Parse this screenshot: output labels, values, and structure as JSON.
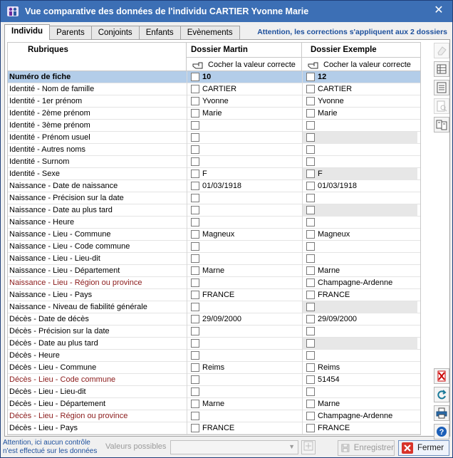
{
  "window": {
    "title": "Vue comparative des données de l'individu  CARTIER Yvonne Marie",
    "close_glyph": "✕"
  },
  "tabs": [
    {
      "label": "Individu",
      "active": true
    },
    {
      "label": "Parents",
      "active": false
    },
    {
      "label": "Conjoints",
      "active": false
    },
    {
      "label": "Enfants",
      "active": false
    },
    {
      "label": "Evènements",
      "active": false
    }
  ],
  "warning_top": "Attention, les corrections s'appliquent aux 2 dossiers",
  "grid": {
    "header": {
      "rubriques": "Rubriques",
      "dossier_a": "Dossier Martin",
      "dossier_b": "Dossier Exemple",
      "check_label_a": "Cocher la valeur correcte",
      "check_label_b": "Cocher la valeur correcte"
    },
    "rows": [
      {
        "label": "Numéro de fiche",
        "a": "10",
        "b": "12",
        "selected": true
      },
      {
        "label": "Identité - Nom de famille",
        "a": "CARTIER",
        "b": "CARTIER"
      },
      {
        "label": "Identité - 1er prénom",
        "a": "Yvonne",
        "b": "Yvonne"
      },
      {
        "label": "Identité - 2ème prénom",
        "a": "Marie",
        "b": "Marie"
      },
      {
        "label": "Identité - 3ème prénom",
        "a": "",
        "b": ""
      },
      {
        "label": "Identité - Prénom usuel",
        "a": "",
        "b": "",
        "grey_b": true
      },
      {
        "label": "Identité - Autres noms",
        "a": "",
        "b": ""
      },
      {
        "label": "Identité - Surnom",
        "a": "",
        "b": ""
      },
      {
        "label": "Identité - Sexe",
        "a": "F",
        "b": "F",
        "grey_b": true
      },
      {
        "label": "Naissance - Date de naissance",
        "a": "01/03/1918",
        "b": "01/03/1918"
      },
      {
        "label": "Naissance - Précision sur la date",
        "a": "",
        "b": ""
      },
      {
        "label": "Naissance - Date au plus tard",
        "a": "",
        "b": "",
        "grey_b": true
      },
      {
        "label": "Naissance - Heure",
        "a": "",
        "b": ""
      },
      {
        "label": "Naissance - Lieu - Commune",
        "a": "Magneux",
        "b": "Magneux"
      },
      {
        "label": "Naissance - Lieu - Code commune",
        "a": "",
        "b": ""
      },
      {
        "label": "Naissance - Lieu - Lieu-dit",
        "a": "",
        "b": ""
      },
      {
        "label": "Naissance - Lieu - Département",
        "a": "Marne",
        "b": "Marne"
      },
      {
        "label": "Naissance - Lieu - Région ou province",
        "a": "",
        "b": "Champagne-Ardenne",
        "red": true
      },
      {
        "label": "Naissance - Lieu - Pays",
        "a": "FRANCE",
        "b": "FRANCE"
      },
      {
        "label": "Naissance - Niveau de fiabilité générale",
        "a": "",
        "b": "",
        "grey_b": true
      },
      {
        "label": "Décès - Date de décès",
        "a": "29/09/2000",
        "b": "29/09/2000"
      },
      {
        "label": "Décès - Précision sur la date",
        "a": "",
        "b": ""
      },
      {
        "label": "Décès - Date au plus tard",
        "a": "",
        "b": "",
        "grey_b": true
      },
      {
        "label": "Décès - Heure",
        "a": "",
        "b": ""
      },
      {
        "label": "Décès - Lieu - Commune",
        "a": "Reims",
        "b": "Reims"
      },
      {
        "label": "Décès - Lieu - Code commune",
        "a": "",
        "b": "51454",
        "red": true
      },
      {
        "label": "Décès - Lieu - Lieu-dit",
        "a": "",
        "b": ""
      },
      {
        "label": "Décès - Lieu - Département",
        "a": "Marne",
        "b": "Marne"
      },
      {
        "label": "Décès - Lieu - Région ou province",
        "a": "",
        "b": "Champagne-Ardenne",
        "red": true
      },
      {
        "label": "Décès - Lieu - Pays",
        "a": "FRANCE",
        "b": "FRANCE"
      }
    ]
  },
  "side_tools": [
    {
      "icon": "eraser-icon",
      "enabled": false
    },
    {
      "icon": "table-icon",
      "enabled": true
    },
    {
      "icon": "list-icon",
      "enabled": true
    },
    {
      "icon": "preview-icon",
      "enabled": false
    },
    {
      "icon": "compare-icon",
      "enabled": true
    },
    {
      "icon": "delete-icon",
      "enabled": true
    },
    {
      "icon": "refresh-icon",
      "enabled": true
    },
    {
      "icon": "print-icon",
      "enabled": true
    },
    {
      "icon": "help-icon",
      "enabled": true
    }
  ],
  "footer": {
    "note_line1": "Attention, ici aucun contrôle",
    "note_line2": "n'est effectué sur les données",
    "values_label": "Valeurs possibles",
    "values_selected": "",
    "save_label": "Enregistrer",
    "close_label": "Fermer"
  },
  "colors": {
    "titlebar": "#3c6fb5",
    "selected_row": "#b3cde9",
    "accent_text": "#1c4f9c",
    "red_label": "#8b1b1b"
  }
}
